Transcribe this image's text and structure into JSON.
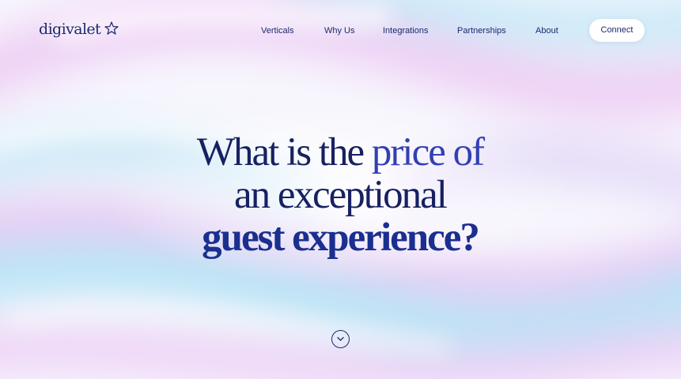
{
  "brand": {
    "name": "digivalet",
    "logo_icon": "star-outline-icon",
    "color": "#1c2a6e"
  },
  "nav": {
    "items": [
      {
        "label": "Verticals"
      },
      {
        "label": "Why Us"
      },
      {
        "label": "Integrations"
      },
      {
        "label": "Partnerships"
      },
      {
        "label": "About"
      }
    ],
    "cta_label": "Connect"
  },
  "hero": {
    "line1": {
      "part1": "What is the ",
      "part2": "price of"
    },
    "line2": "an exceptional",
    "line3": "guest experience?"
  },
  "scroll": {
    "icon": "chevron-down-icon"
  },
  "colors": {
    "heading_dark": "#172161",
    "heading_blue": "#3340b2",
    "background_base": "#f7f6fd",
    "wave_pink": "#e6bff0",
    "wave_cyan": "#a8e2f4"
  }
}
